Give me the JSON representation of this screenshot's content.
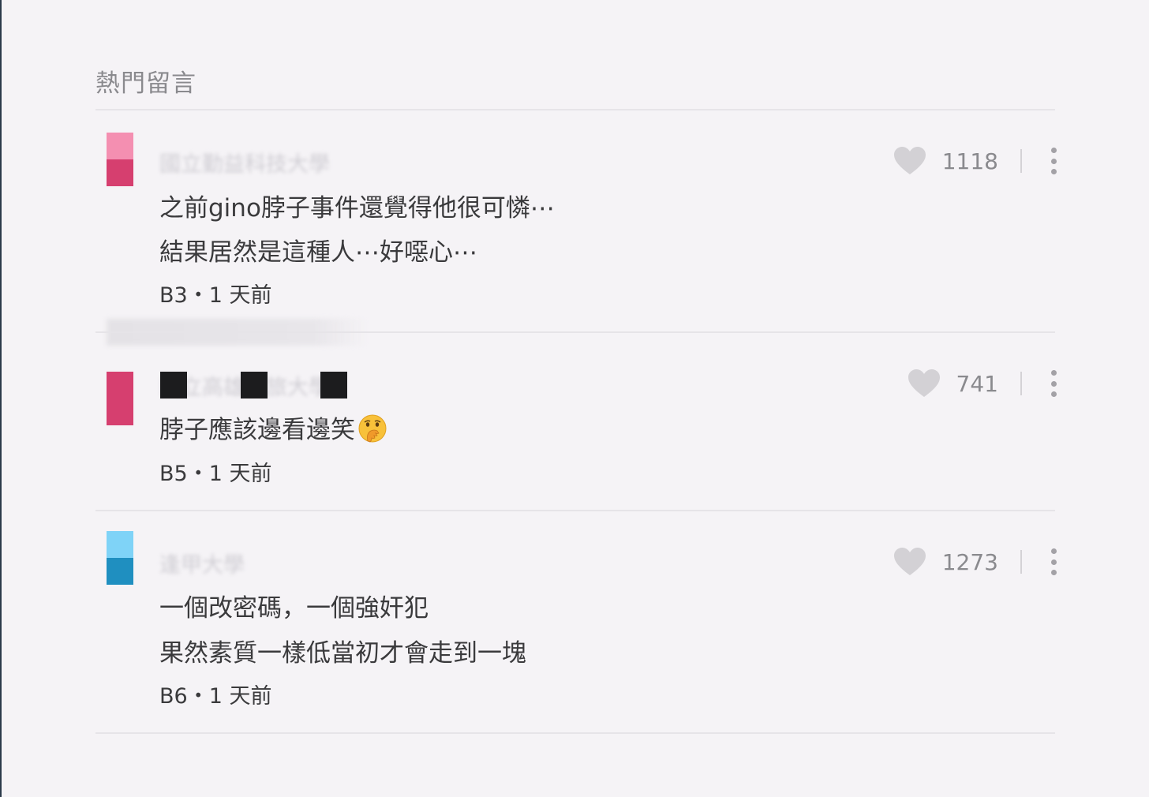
{
  "section_title": "熱門留言",
  "colors": {
    "background": "#f5f3f6",
    "divider": "#e6e4e8",
    "text": "#3a3a3c",
    "muted": "#8a8a8e",
    "heart": "#d3d1d5"
  },
  "comments": [
    {
      "school": "國立勤益科技大學",
      "avatar_colors": [
        "#f48fb1",
        "#d63f6f"
      ],
      "lines": [
        "之前gino脖子事件還覺得他很可憐⋯",
        "結果居然是這種人⋯好噁心⋯"
      ],
      "floor": "B3",
      "time": "1 天前",
      "meta": "B3・1 天前",
      "likes": "1118",
      "like_icon": "heart-icon",
      "more_icon": "more-vertical-icon"
    },
    {
      "school": "國立高雄餐旅大學",
      "avatar_colors": [
        "#d63f6f",
        "#d63f6f"
      ],
      "lines": [
        "脖子應該邊看邊笑"
      ],
      "emoji": "face-with-hand-over-mouth-icon",
      "floor": "B5",
      "time": "1 天前",
      "meta": "B5・1 天前",
      "likes": "741",
      "like_icon": "heart-icon",
      "more_icon": "more-vertical-icon"
    },
    {
      "school": "逢甲大學",
      "avatar_colors": [
        "#7fd3f7",
        "#1f8fc0"
      ],
      "lines": [
        "一個改密碼，一個強奸犯",
        "果然素質一樣低當初才會走到一塊"
      ],
      "floor": "B6",
      "time": "1 天前",
      "meta": "B6・1 天前",
      "likes": "1273",
      "like_icon": "heart-icon",
      "more_icon": "more-vertical-icon"
    }
  ]
}
